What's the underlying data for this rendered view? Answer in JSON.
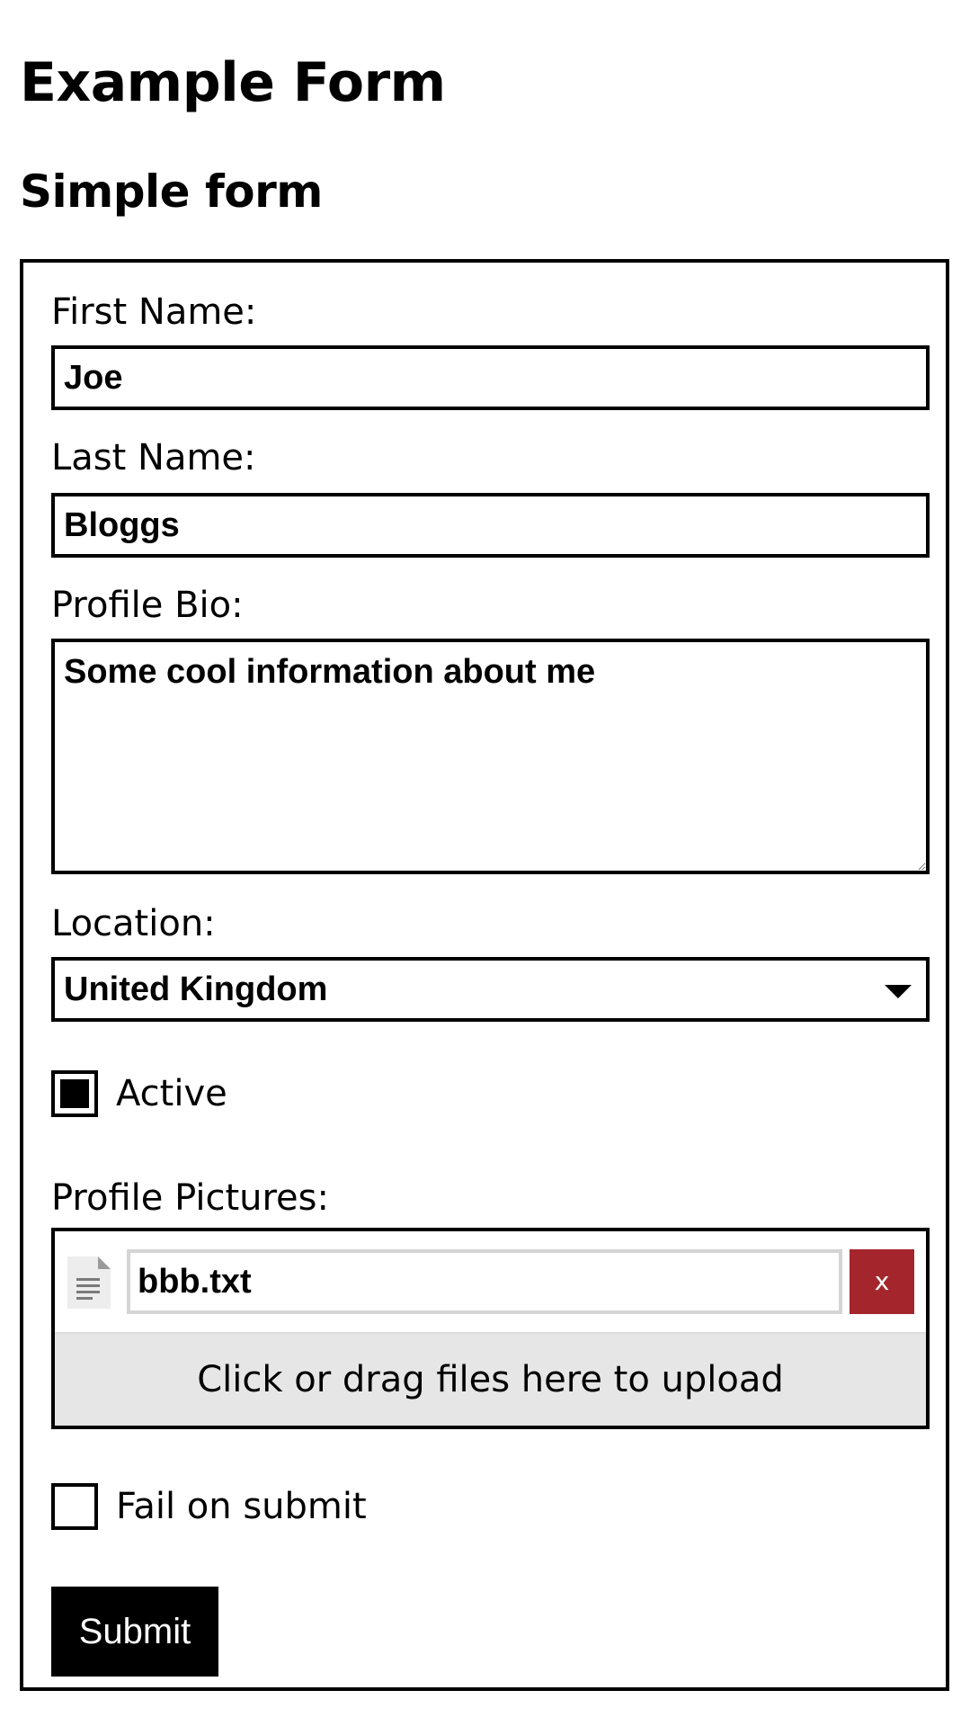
{
  "page": {
    "title": "Example Form",
    "section_title": "Simple form"
  },
  "form": {
    "first_name": {
      "label": "First Name:",
      "value": "Joe"
    },
    "last_name": {
      "label": "Last Name:",
      "value": "Bloggs"
    },
    "bio": {
      "label": "Profile Bio:",
      "value": "Some cool information about me"
    },
    "location": {
      "label": "Location:",
      "selected": "United Kingdom"
    },
    "active": {
      "label": "Active",
      "checked": true
    },
    "pictures": {
      "label": "Profile Pictures:",
      "files": [
        {
          "name": "bbb.txt",
          "icon": "document-icon"
        }
      ],
      "remove_label": "x",
      "dropzone_text": "Click or drag files here to upload"
    },
    "fail_on_submit": {
      "label": "Fail on submit",
      "checked": false
    },
    "submit_label": "Submit"
  },
  "colors": {
    "border": "#000000",
    "remove_button": "#a4262c",
    "dropzone_bg": "#e6e6e6",
    "submit_bg": "#000000"
  }
}
